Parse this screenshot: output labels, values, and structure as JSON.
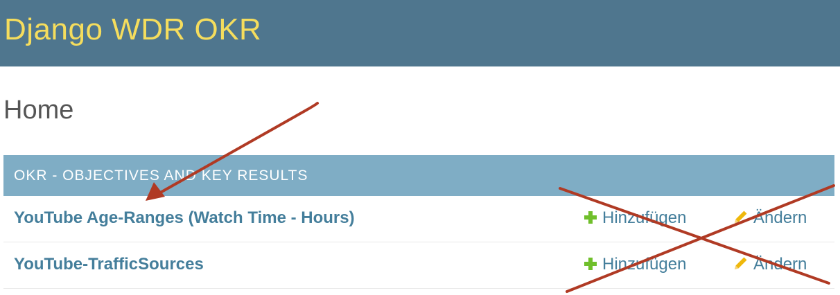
{
  "header": {
    "site_title": "Django WDR OKR"
  },
  "page": {
    "title": "Home"
  },
  "module": {
    "caption": "OKR - Objectives and Key Results",
    "rows": [
      {
        "model": "YouTube Age-Ranges (Watch Time - Hours)",
        "add_label": "Hinzufügen",
        "change_label": "Ändern"
      },
      {
        "model": "YouTube-TrafficSources",
        "add_label": "Hinzufügen",
        "change_label": "Ändern"
      }
    ]
  },
  "colors": {
    "header_bg": "#4f768e",
    "site_title": "#f5dd5d",
    "module_caption_bg": "#7fadc5",
    "link": "#447e9b",
    "add_icon": "#70bf2b",
    "change_icon": "#efb80b",
    "annotation": "#b03a24"
  },
  "icons": {
    "add": "plus-icon",
    "change": "pencil-icon"
  }
}
